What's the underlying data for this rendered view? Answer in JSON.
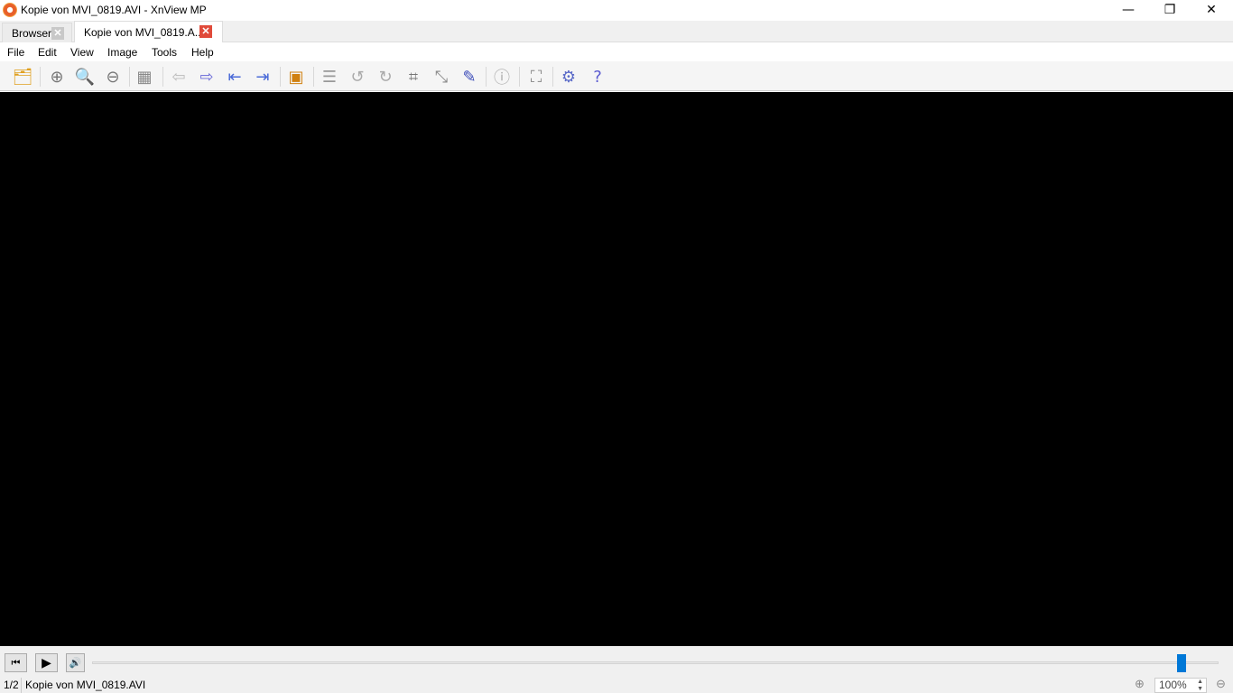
{
  "window": {
    "title": "Kopie von MVI_0819.AVI - XnView MP",
    "minimize": "—",
    "restore": "❐",
    "close": "✕"
  },
  "tabs": [
    {
      "label": "Browser"
    },
    {
      "label": "Kopie von MVI_0819.A..."
    }
  ],
  "menu": [
    "File",
    "Edit",
    "View",
    "Image",
    "Tools",
    "Help"
  ],
  "toolbar": [
    {
      "name": "folders-icon",
      "glyph": "🗂"
    },
    {
      "name": "zoom-in-icon",
      "glyph": "⊕"
    },
    {
      "name": "zoom-1to1-icon",
      "glyph": "🔍"
    },
    {
      "name": "zoom-out-icon",
      "glyph": "⊖"
    },
    {
      "name": "grid-icon",
      "glyph": "▦"
    },
    {
      "name": "previous-icon",
      "glyph": "⇦"
    },
    {
      "name": "next-icon",
      "glyph": "⇨"
    },
    {
      "name": "first-icon",
      "glyph": "⇤"
    },
    {
      "name": "last-icon",
      "glyph": "⇥"
    },
    {
      "name": "slideshow-icon",
      "glyph": "▣"
    },
    {
      "name": "adjust-icon",
      "glyph": "☰"
    },
    {
      "name": "rotate-left-icon",
      "glyph": "↺"
    },
    {
      "name": "rotate-right-icon",
      "glyph": "↻"
    },
    {
      "name": "crop-icon",
      "glyph": "⌗"
    },
    {
      "name": "resize-icon",
      "glyph": "⤡"
    },
    {
      "name": "edit-text-icon",
      "glyph": "✎"
    },
    {
      "name": "info-icon",
      "glyph": "ⓘ"
    },
    {
      "name": "fullscreen-icon",
      "glyph": "⛶"
    },
    {
      "name": "settings-icon",
      "glyph": "⚙"
    },
    {
      "name": "help-icon",
      "glyph": "?"
    }
  ],
  "player": {
    "rewind": "⏮",
    "play": "▶",
    "volume": "🔊",
    "position_fraction": 0.967,
    "accent": "#0078d7"
  },
  "status": {
    "index": "1/2",
    "filename": "Kopie von MVI_0819.AVI",
    "zoom": "100%"
  }
}
